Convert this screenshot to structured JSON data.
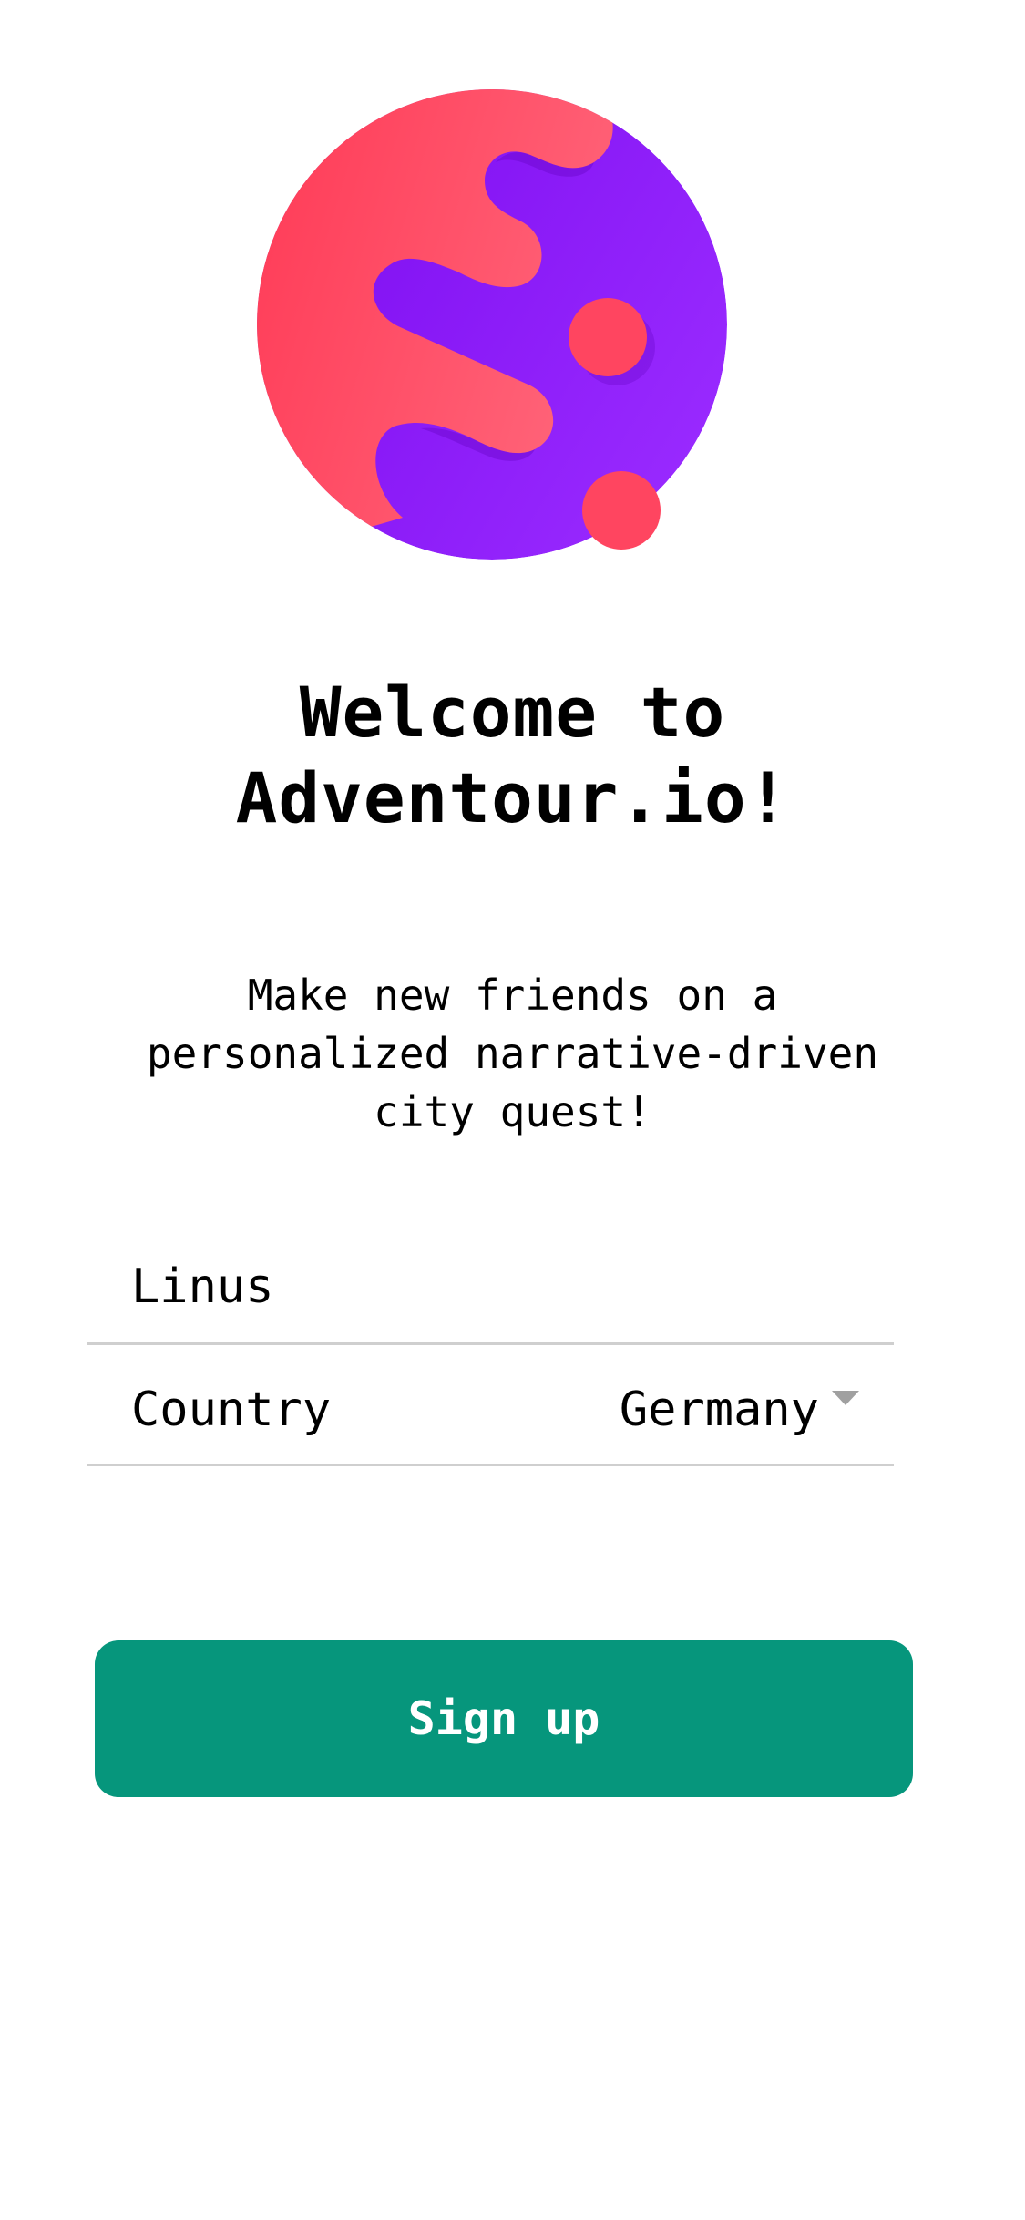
{
  "app": {
    "logo_icon": "adventour-logo-icon"
  },
  "welcome": {
    "title_line1": "Welcome to",
    "title_line2": "Adventour.io!",
    "subtitle": "Make new friends on a personalized narrative-driven city quest!"
  },
  "form": {
    "name_value": "Linus",
    "country_label": "Country",
    "country_value": "Germany"
  },
  "actions": {
    "signup_label": "Sign up"
  },
  "colors": {
    "accent": "#06967c",
    "logo_red": "#ff3c57",
    "logo_purple": "#8a12f5",
    "divider": "#cfcfcf"
  }
}
